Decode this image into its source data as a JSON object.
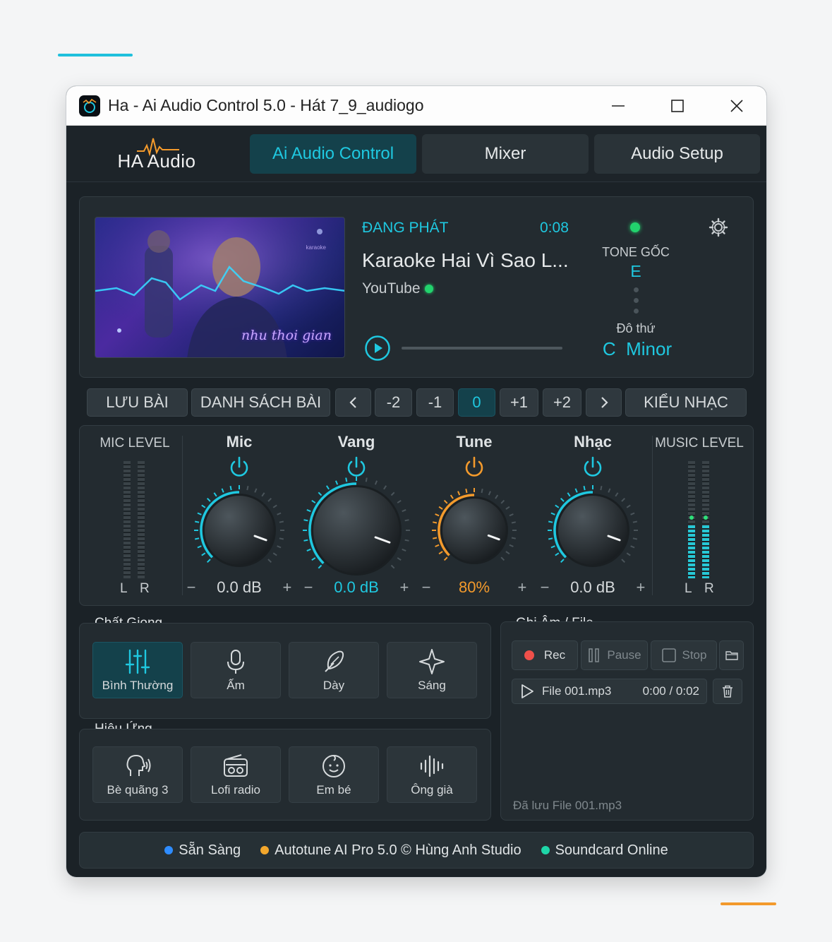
{
  "window": {
    "title": "Ha - Ai Audio Control 5.0 - Hát 7_9_audiogo"
  },
  "brand": {
    "logo_text": "HA Audio"
  },
  "tabs": [
    {
      "label": "Ai Audio Control",
      "active": true
    },
    {
      "label": "Mixer",
      "active": false
    },
    {
      "label": "Audio Setup",
      "active": false
    }
  ],
  "player": {
    "status_label": "ĐANG PHÁT",
    "time": "0:08",
    "song_title": "Karaoke Hai Vì Sao L...",
    "source": "YouTube",
    "thumbnail_caption": "nhu thoi gian",
    "thumbnail_corner_text": "karaoke",
    "progress": 0.0
  },
  "tone": {
    "original_label": "TONE GỐC",
    "original_key": "E",
    "mode_label": "Đô thứ",
    "key_note": "C",
    "key_mode": "Minor"
  },
  "controls": {
    "save_song": "LƯU BÀI",
    "song_list": "DANH SÁCH BÀI",
    "prev": "<",
    "next": ">",
    "transpose": [
      "-2",
      "-1",
      "0",
      "+1",
      "+2"
    ],
    "transpose_active": "0",
    "music_style": "KIỂU NHẠC"
  },
  "mixer": {
    "mic_level_label": "MIC LEVEL",
    "music_level_label": "MUSIC LEVEL",
    "left": "L",
    "right": "R",
    "minus": "−",
    "plus": "+",
    "mic_level": [
      0,
      0
    ],
    "music_level": [
      0.45,
      0.45
    ],
    "knobs": [
      {
        "name": "Mic",
        "value": "0.0 dB",
        "level": 0.5,
        "color": "#1fc8e0"
      },
      {
        "name": "Vang",
        "value": "0.0 dB",
        "level": 0.5,
        "color": "#1fc8e0"
      },
      {
        "name": "Tune",
        "value": "80%",
        "level": 0.5,
        "color": "#f39a2c"
      },
      {
        "name": "Nhạc",
        "value": "0.0 dB",
        "level": 0.5,
        "color": "#1fc8e0"
      }
    ]
  },
  "voice": {
    "title": "Chất Giọng",
    "items": [
      {
        "label": "Bình Thường",
        "icon": "sliders-icon",
        "active": true
      },
      {
        "label": "Ấm",
        "icon": "microphone-icon",
        "active": false
      },
      {
        "label": "Dày",
        "icon": "feather-icon",
        "active": false
      },
      {
        "label": "Sáng",
        "icon": "sparkle-icon",
        "active": false
      }
    ]
  },
  "effects": {
    "title": "Hiệu Ứng",
    "items": [
      {
        "label": "Bè quãng 3",
        "icon": "head-voice-icon"
      },
      {
        "label": "Lofi radio",
        "icon": "radio-icon"
      },
      {
        "label": "Em bé",
        "icon": "baby-icon"
      },
      {
        "label": "Ông già",
        "icon": "waveform-icon"
      }
    ]
  },
  "recording": {
    "title": "Ghi Âm / File",
    "rec": "Rec",
    "pause": "Pause",
    "stop": "Stop",
    "file_name": "File 001.mp3",
    "file_time": "0:00 / 0:02",
    "saved_message": "Đã lưu File 001.mp3"
  },
  "status_bar": {
    "ready": "Sẵn Sàng",
    "product": "Autotune AI Pro 5.0 © Hùng Anh Studio",
    "soundcard": "Soundcard Online"
  },
  "colors": {
    "accent": "#1fc8e0",
    "tune": "#f39a2c",
    "online": "#22d36d",
    "ready": "#2e8cff",
    "product": "#f3a72c",
    "soundcard": "#1ed6a8"
  }
}
